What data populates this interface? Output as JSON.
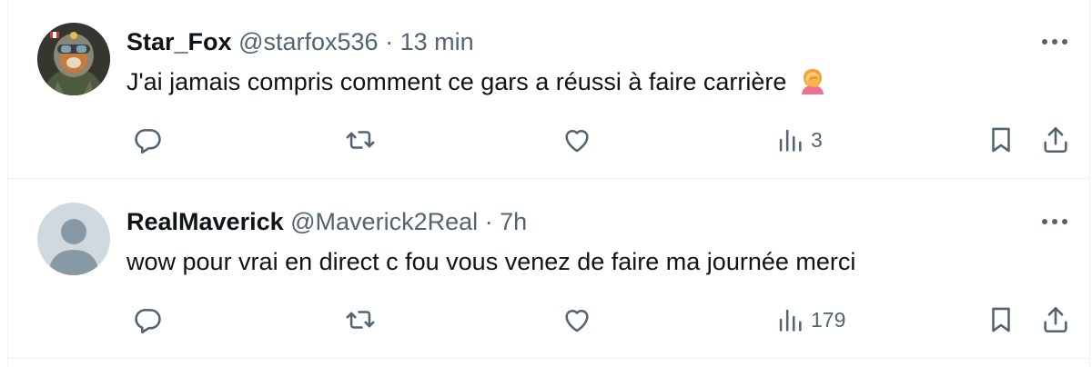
{
  "tweets": [
    {
      "display_name": "Star_Fox",
      "handle": "@starfox536",
      "separator": "·",
      "time": "13 min",
      "text": "J'ai jamais compris comment ce gars a réussi à faire carrière",
      "emoji": "person-facepalming",
      "avatar": "space-pilot-avatar",
      "views": "3"
    },
    {
      "display_name": "RealMaverick",
      "handle": "@Maverick2Real",
      "separator": "·",
      "time": "7h",
      "text": "wow pour vrai en direct c fou vous venez de faire ma journée merci",
      "avatar": "default-avatar",
      "views": "179"
    }
  ],
  "colors": {
    "text": "#0f1419",
    "secondary": "#536471",
    "divider": "#eff3f4",
    "default_avatar_bg": "#cfd9de",
    "default_avatar_fg": "#8899a6"
  },
  "icons": [
    "more-icon",
    "reply-icon",
    "retweet-icon",
    "like-icon",
    "views-icon",
    "bookmark-icon",
    "share-icon"
  ]
}
